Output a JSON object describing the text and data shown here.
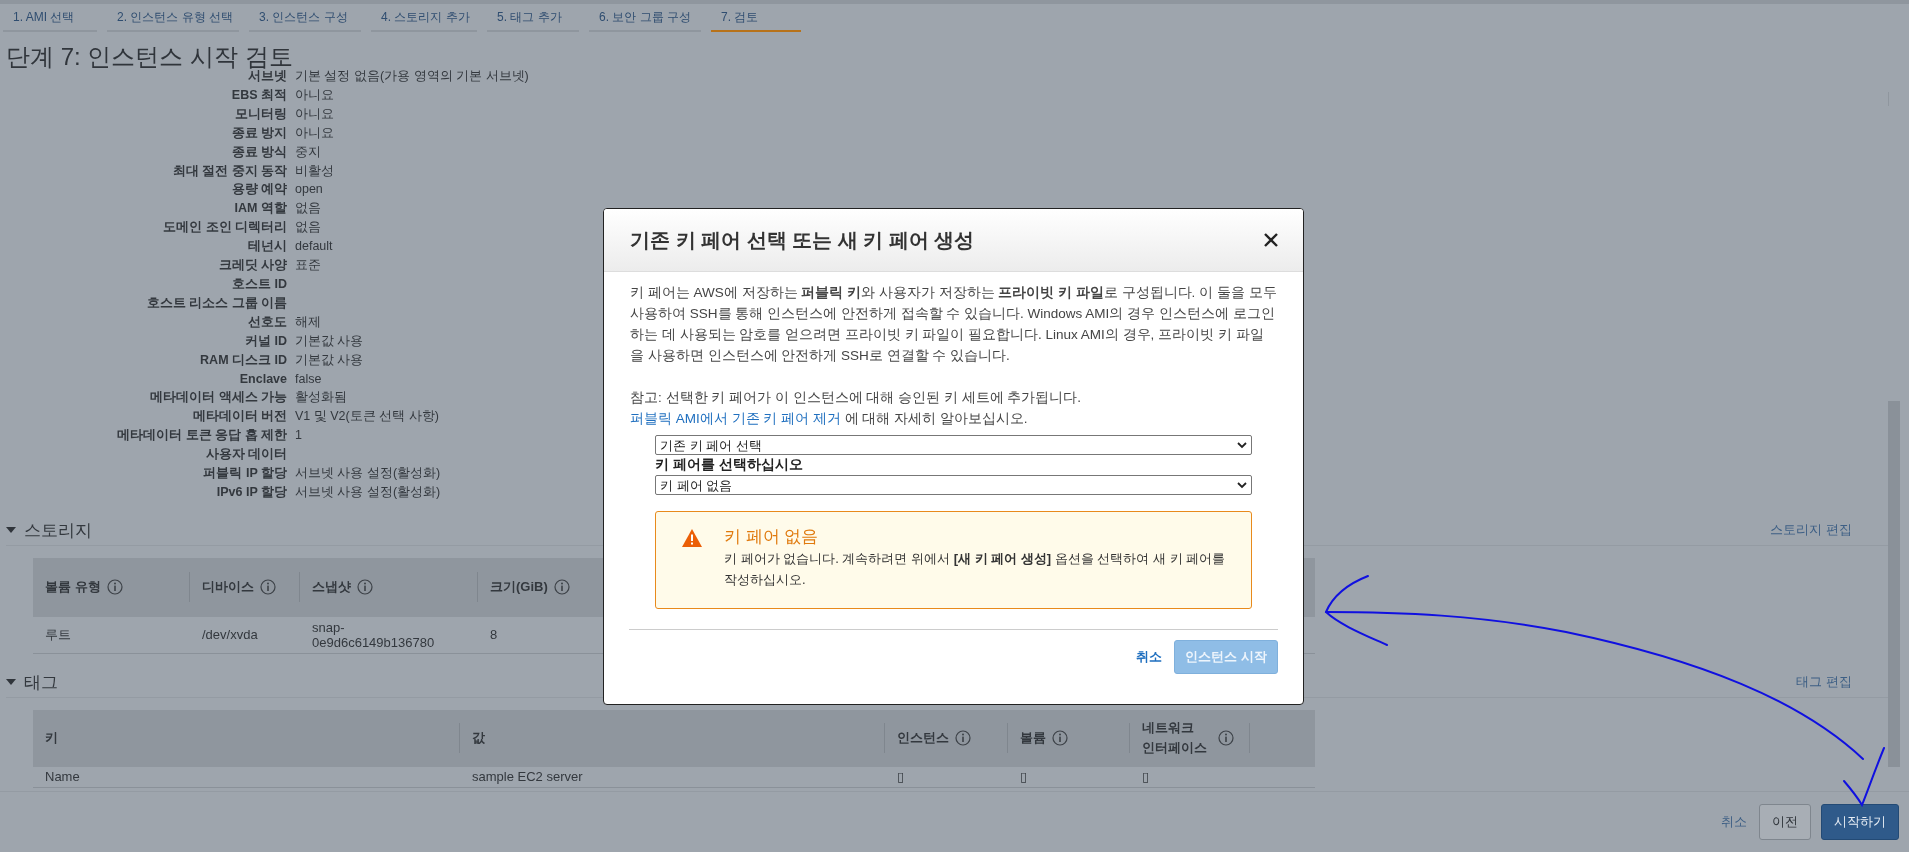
{
  "wizard_steps": [
    {
      "label": "1. AMI 선택",
      "selected": false
    },
    {
      "label": "2. 인스턴스 유형 선택",
      "selected": false
    },
    {
      "label": "3. 인스턴스 구성",
      "selected": false
    },
    {
      "label": "4. 스토리지 추가",
      "selected": false
    },
    {
      "label": "5. 태그 추가",
      "selected": false
    },
    {
      "label": "6. 보안 그룹 구성",
      "selected": false
    },
    {
      "label": "7. 검토",
      "selected": true
    }
  ],
  "page_title": "단계 7: 인스턴스 시작 검토",
  "details": [
    {
      "label": "서브넷",
      "value": "기본 설정 없음(가용 영역의 기본 서브넷)"
    },
    {
      "label": "EBS 최적",
      "value": "아니요"
    },
    {
      "label": "모니터링",
      "value": "아니요"
    },
    {
      "label": "종료 방지",
      "value": "아니요"
    },
    {
      "label": "종료 방식",
      "value": "중지"
    },
    {
      "label": "최대 절전 중지 동작",
      "value": "비활성"
    },
    {
      "label": "용량 예약",
      "value": "open"
    },
    {
      "label": "IAM 역할",
      "value": "없음"
    },
    {
      "label": "도메인 조인 디렉터리",
      "value": "없음"
    },
    {
      "label": "테넌시",
      "value": "default"
    },
    {
      "label": "크레딧 사양",
      "value": "표준"
    },
    {
      "label": "호스트 ID"
    },
    {
      "label": "호스트 리소스 그룹 이름"
    },
    {
      "label": "선호도",
      "value": "해제"
    },
    {
      "label": "커널 ID",
      "value": "기본값 사용"
    },
    {
      "label": "RAM 디스크 ID",
      "value": "기본값 사용"
    },
    {
      "label": "Enclave",
      "value": "false"
    },
    {
      "label": "메타데이터 액세스 가능",
      "value": "활성화됨"
    },
    {
      "label": "메타데이터 버전",
      "value": "V1 및 V2(토큰 선택 사항)"
    },
    {
      "label": "메타데이터 토큰 응답 홉 제한",
      "value": "1"
    },
    {
      "label": "사용자 데이터"
    },
    {
      "label": "퍼블릭 IP 할당",
      "value": "서브넷 사용 설정(활성화)"
    },
    {
      "label": "IPv6 IP 할당",
      "value": "서브넷 사용 설정(활성화)"
    }
  ],
  "storage": {
    "title": "스토리지",
    "expanded": true,
    "edit_link": "스토리지 편집",
    "columns": [
      {
        "label": "볼륨 유형",
        "info": true
      },
      {
        "label": "디바이스",
        "info": true
      },
      {
        "label": "스냅샷",
        "info": true
      },
      {
        "label": "크기(GiB)",
        "info": true
      }
    ],
    "rows": [
      [
        "루트",
        "/dev/xvda",
        "snap-0e9d6c6149b136780",
        "8"
      ]
    ]
  },
  "tags": {
    "title": "태그",
    "expanded": true,
    "edit_link": "태그 편집",
    "columns": [
      {
        "label": "키",
        "info": false
      },
      {
        "label": "값",
        "info": false
      },
      {
        "label": "인스턴스",
        "info": true
      },
      {
        "label": "볼륨",
        "info": true
      },
      {
        "label": "네트워크 인터페이스",
        "info": true
      }
    ],
    "rows": [
      [
        "Name",
        "sample EC2 server",
        "▯",
        "▯",
        "▯"
      ]
    ]
  },
  "footer_buttons": [
    {
      "label": "취소",
      "kind": "link"
    },
    {
      "label": "이전",
      "kind": "secondary"
    },
    {
      "label": "시작하기",
      "kind": "primary"
    }
  ],
  "dialog": {
    "title": "기존 키 페어 선택 또는 새 키 페어 생성",
    "intro": "키 페어는 AWS에 저장하는 **퍼블릭 키**와 사용자가 저장하는 **프라이빗 키 파일**로 구성됩니다. 이 둘을 모두 사용하여 SSH를 통해 인스턴스에 안전하게 접속할 수 있습니다. Windows AMI의 경우 인스턴스에 로그인하는 데 사용되는 암호를 얻으려면 프라이빗 키 파일이 필요합니다. Linux AMI의 경우, 프라이빗 키 파일을 사용하면 인스턴스에 안전하게 SSH로 연결할 수 있습니다.",
    "note": "참고: 선택한 키 페어가 이 인스턴스에 대해 승인된 키 세트에 추가됩니다.",
    "note_link": "퍼블릭 AMI에서 기존 키 페어 제거",
    "note_after": "에 대해 자세히 알아보십시오.",
    "mode_select": {
      "value": "기존 키 페어 선택"
    },
    "key_label": "키 페어를 선택하십시오",
    "key_select": {
      "value": "키 페어 없음"
    },
    "alert": {
      "title": "키 페어 없음",
      "text": "키 페어가 없습니다. 계속하려면 위에서 **[새 키 페어 생성]** 옵션을 선택하여 새 키 페어를 작성하십시오."
    },
    "buttons": [
      {
        "label": "취소",
        "kind": "link",
        "disabled": false
      },
      {
        "label": "인스턴스 시작",
        "kind": "primary",
        "disabled": true
      }
    ]
  }
}
